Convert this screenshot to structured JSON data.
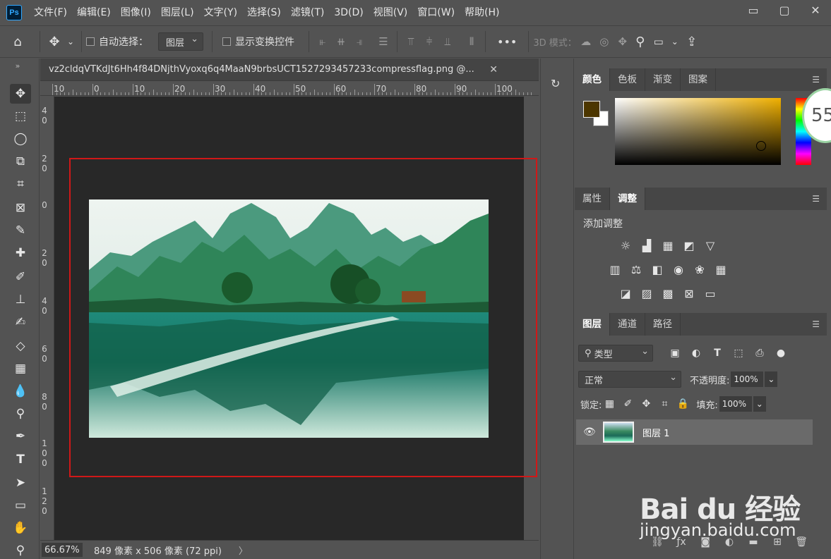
{
  "app": {
    "logo": "Ps"
  },
  "menu": [
    "文件(F)",
    "编辑(E)",
    "图像(I)",
    "图层(L)",
    "文字(Y)",
    "选择(S)",
    "滤镜(T)",
    "3D(D)",
    "视图(V)",
    "窗口(W)",
    "帮助(H)"
  ],
  "window_controls": {
    "minimize": "▭",
    "restore": "▢",
    "close": "✕"
  },
  "options": {
    "auto_select_label": "自动选择：",
    "auto_select_value": "图层",
    "show_transform_label": "显示变换控件",
    "more": "•••",
    "mode_3d_label": "3D 模式："
  },
  "document": {
    "tab_title": "vz2cldqVTKdJt6Hh4f84DNjthVyoxq6q4MaaN9brbsUCT1527293457233compressflag.png @...",
    "close": "✕",
    "zoom": "66.67%",
    "info": "849 像素 x 506 像素 (72 ppi)",
    "status_arrow": "〉"
  },
  "ruler": {
    "top": [
      "10",
      "0",
      "10",
      "20",
      "30",
      "40",
      "50",
      "60",
      "70",
      "80",
      "90",
      "100"
    ],
    "left": [
      "4\n0",
      "2\n0",
      "0",
      "2\n0",
      "4\n0",
      "6\n0",
      "8\n0",
      "1\n0\n0",
      "1\n2\n0"
    ]
  },
  "color_panel": {
    "tabs": [
      "颜色",
      "色板",
      "渐变",
      "图案"
    ],
    "foreground": "#4c3600",
    "background": "#ffffff",
    "badge_value": "55"
  },
  "adjust_panel": {
    "tabs": [
      "属性",
      "调整"
    ],
    "title": "添加调整"
  },
  "layers_panel": {
    "tabs": [
      "图层",
      "通道",
      "路径"
    ],
    "filter_label": "类型",
    "blend_mode": "正常",
    "opacity_label": "不透明度:",
    "opacity_value": "100%",
    "lock_label": "锁定:",
    "fill_label": "填充:",
    "fill_value": "100%",
    "layer_name": "图层 1"
  },
  "watermark": {
    "logo": "Bai du 经验",
    "url": "jingyan.baidu.com"
  }
}
